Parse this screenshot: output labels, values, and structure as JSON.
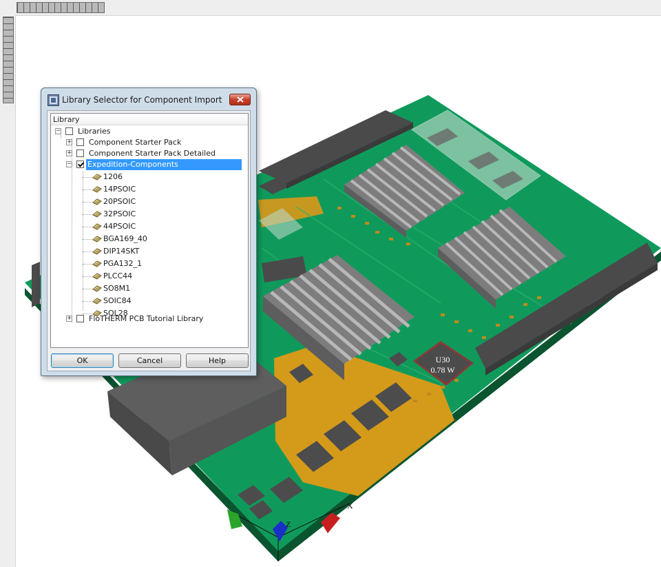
{
  "dialog": {
    "title": "Library Selector for Component Import",
    "header": "Library",
    "root": "Libraries",
    "libraries": [
      {
        "label": "Component Starter Pack",
        "checked": false,
        "expanded": false
      },
      {
        "label": "Component Starter Pack Detailed",
        "checked": false,
        "expanded": false
      },
      {
        "label": "Expedition-Components",
        "checked": true,
        "expanded": true,
        "selected": true
      }
    ],
    "components": [
      "1206",
      "14PSOIC",
      "20PSOIC",
      "32PSOIC",
      "44PSOIC",
      "BGA169_40",
      "DIP14SKT",
      "PGA132_1",
      "PLCC44",
      "SO8M1",
      "SOIC84",
      "SOL28"
    ],
    "last_library": {
      "label": "FloTHERM PCB Tutorial Library",
      "checked": false,
      "expanded": false
    },
    "buttons": {
      "ok": "OK",
      "cancel": "Cancel",
      "help": "Help"
    }
  },
  "viewport": {
    "component_label": "U30",
    "component_power": "0.78 W",
    "axis_x": "X",
    "axis_z": "Z"
  },
  "colors": {
    "board": "#0f9a5b",
    "copper": "#d49a1a",
    "heatsink": "#9d9d9d",
    "selection": "#3399ff"
  }
}
